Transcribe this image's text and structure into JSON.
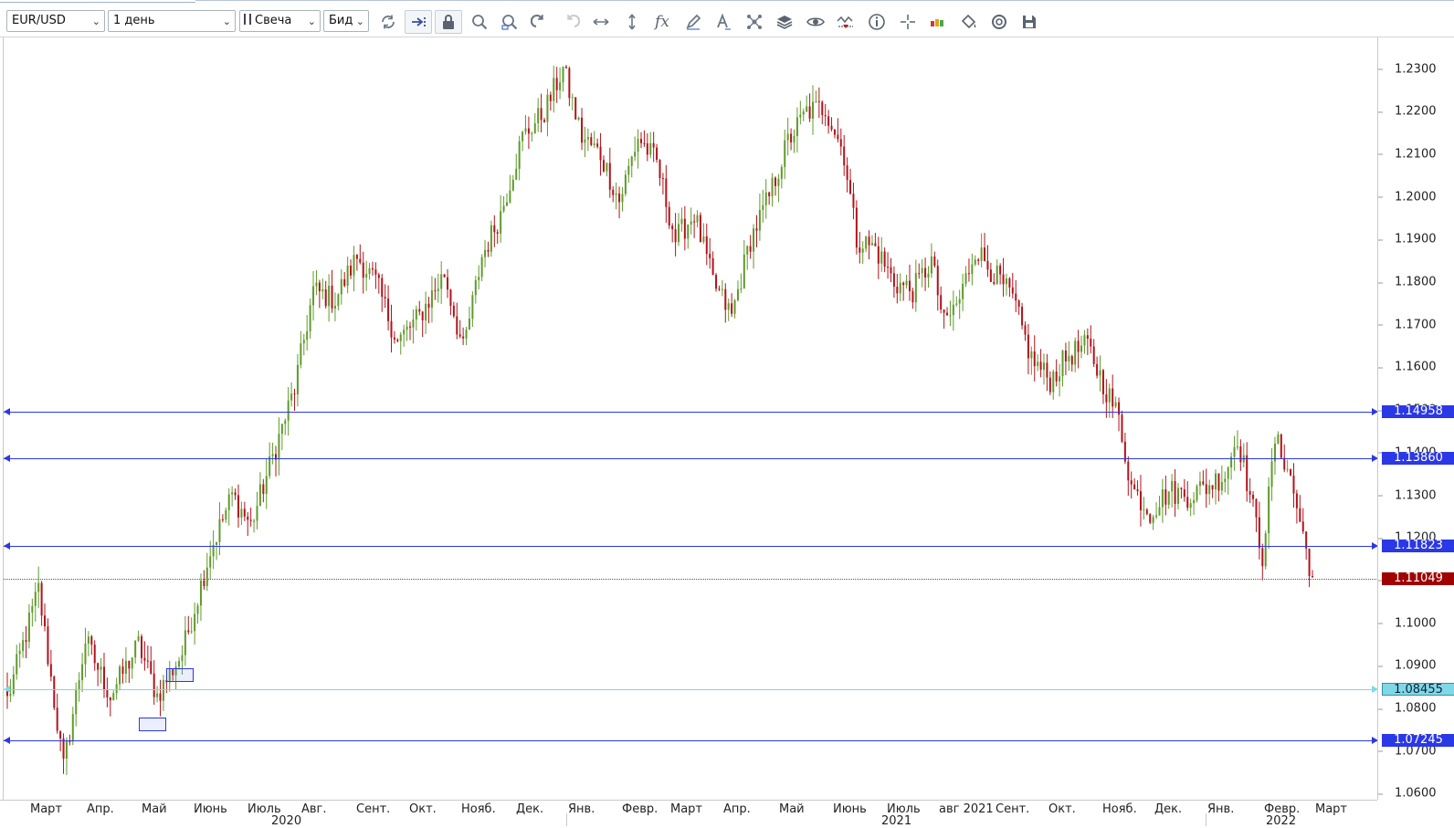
{
  "toolbar": {
    "symbol": "EUR/USD",
    "timeframe": "1 день",
    "chart_type": "Свеча",
    "price_side": "Бид",
    "icons": [
      "refresh-icon",
      "shift-right-icon",
      "lock-icon",
      "zoom-in-icon",
      "zoom-out-icon",
      "undo-icon",
      "redo-icon",
      "horizontal-scale-icon",
      "vertical-scale-icon",
      "indicator-fx-icon",
      "pencil-icon",
      "text-tool-icon",
      "network-icon",
      "layers-icon",
      "eye-icon",
      "zigzag-icon",
      "info-icon",
      "crosshair-icon",
      "color-bars-icon",
      "paint-bucket-icon",
      "rotate-icon",
      "save-icon"
    ]
  },
  "chart_data": {
    "type": "candlestick",
    "symbol": "EUR/USD",
    "y_range": [
      1.0586,
      1.2374
    ],
    "y_ticks": [
      "1.2300",
      "1.2200",
      "1.2100",
      "1.2000",
      "1.1900",
      "1.1800",
      "1.1700",
      "1.1600",
      "1.1500",
      "1.1400",
      "1.1300",
      "1.1200",
      "1.1100",
      "1.1000",
      "1.0900",
      "1.0800",
      "1.0700",
      "1.0600"
    ],
    "current_price": "1.11049",
    "levels": [
      {
        "value": "1.14958",
        "color": "#2b38e6"
      },
      {
        "value": "1.13860",
        "color": "#2b38e6"
      },
      {
        "value": "1.11823",
        "color": "#2b38e6"
      },
      {
        "value": "1.08455",
        "color": "#7fd8e8"
      },
      {
        "value": "1.07245",
        "color": "#2b38e6"
      }
    ],
    "months": [
      "Март",
      "Апр.",
      "Май",
      "Июнь",
      "Июль",
      "Авг.",
      "Сент.",
      "Окт.",
      "Нояб.",
      "Дек.",
      "Янв.",
      "Февр.",
      "Март",
      "Апр.",
      "Май",
      "Июнь",
      "Июль",
      "авг 2021",
      "Сент.",
      "Окт.",
      "Нояб.",
      "Дек.",
      "Янв.",
      "Февр.",
      "Март"
    ],
    "years": [
      "2020",
      "2021",
      "2022"
    ],
    "close_path": [
      [
        0,
        1.082
      ],
      [
        10,
        1.108
      ],
      [
        18,
        1.066
      ],
      [
        25,
        1.096
      ],
      [
        33,
        1.083
      ],
      [
        42,
        1.095
      ],
      [
        48,
        1.083
      ],
      [
        56,
        1.093
      ],
      [
        65,
        1.117
      ],
      [
        72,
        1.13
      ],
      [
        78,
        1.123
      ],
      [
        85,
        1.139
      ],
      [
        92,
        1.155
      ],
      [
        98,
        1.178
      ],
      [
        105,
        1.176
      ],
      [
        112,
        1.186
      ],
      [
        118,
        1.18
      ],
      [
        125,
        1.166
      ],
      [
        132,
        1.172
      ],
      [
        140,
        1.182
      ],
      [
        146,
        1.164
      ],
      [
        152,
        1.186
      ],
      [
        158,
        1.196
      ],
      [
        165,
        1.214
      ],
      [
        172,
        1.22
      ],
      [
        178,
        1.23
      ],
      [
        184,
        1.214
      ],
      [
        190,
        1.21
      ],
      [
        196,
        1.199
      ],
      [
        202,
        1.214
      ],
      [
        208,
        1.208
      ],
      [
        214,
        1.19
      ],
      [
        220,
        1.196
      ],
      [
        226,
        1.18
      ],
      [
        232,
        1.172
      ],
      [
        238,
        1.19
      ],
      [
        244,
        1.2
      ],
      [
        250,
        1.213
      ],
      [
        256,
        1.22
      ],
      [
        262,
        1.221
      ],
      [
        268,
        1.21
      ],
      [
        272,
        1.19
      ],
      [
        278,
        1.188
      ],
      [
        284,
        1.18
      ],
      [
        290,
        1.178
      ],
      [
        296,
        1.185
      ],
      [
        300,
        1.17
      ],
      [
        305,
        1.176
      ],
      [
        310,
        1.188
      ],
      [
        316,
        1.182
      ],
      [
        322,
        1.176
      ],
      [
        328,
        1.162
      ],
      [
        334,
        1.157
      ],
      [
        340,
        1.163
      ],
      [
        346,
        1.165
      ],
      [
        350,
        1.158
      ],
      [
        356,
        1.148
      ],
      [
        360,
        1.132
      ],
      [
        366,
        1.126
      ],
      [
        372,
        1.131
      ],
      [
        378,
        1.13
      ],
      [
        384,
        1.132
      ],
      [
        390,
        1.135
      ],
      [
        394,
        1.144
      ],
      [
        398,
        1.13
      ],
      [
        402,
        1.116
      ],
      [
        406,
        1.143
      ],
      [
        410,
        1.137
      ],
      [
        414,
        1.124
      ],
      [
        418,
        1.1105
      ]
    ]
  }
}
